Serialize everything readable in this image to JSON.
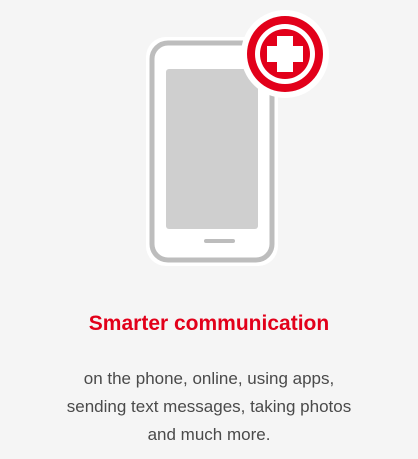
{
  "feature": {
    "icon": "smartphone-with-plus-icon",
    "badge_icon": "red-plus-badge-icon",
    "title": "Smarter communication",
    "description_lines": [
      "on the phone, online, using apps,",
      "sending text messages, taking photos",
      "and much more."
    ]
  },
  "colors": {
    "background": "#f5f5f5",
    "accent": "#e2001a",
    "phone_outline": "#bdbdbd",
    "screen": "#cfcfcf",
    "text": "#4a4a4a"
  }
}
